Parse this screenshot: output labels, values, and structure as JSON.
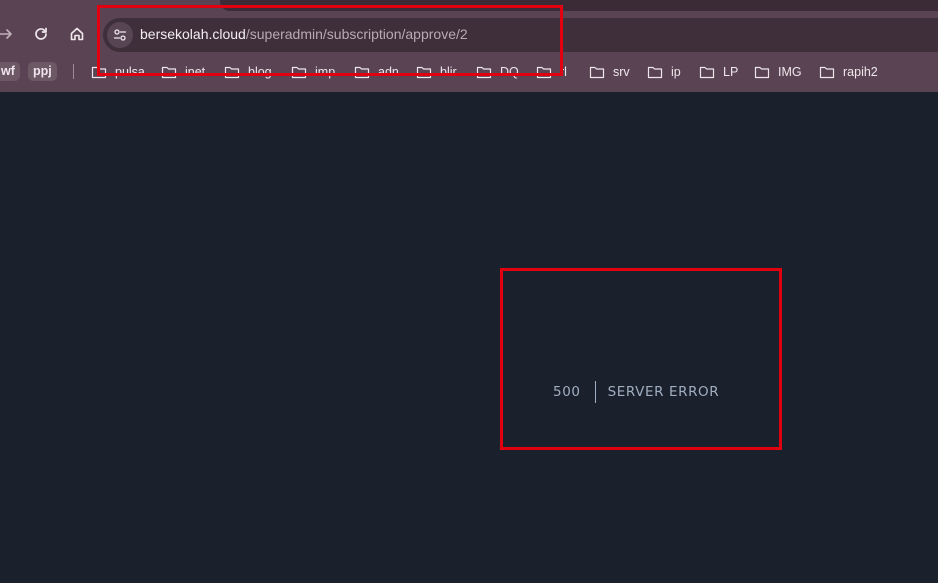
{
  "browser": {
    "url_host": "bersekolah.cloud",
    "url_path": "/superadmin/subscription/approve/2"
  },
  "bookmarks": {
    "chips": [
      "wf",
      "ppj"
    ],
    "folders": [
      "pulsa",
      "inet",
      "blog",
      "imp",
      "adn",
      "blir",
      "DQ",
      "rl",
      "srv",
      "ip",
      "LP",
      "IMG",
      "rapih2"
    ]
  },
  "error": {
    "code": "500",
    "message": "SERVER ERROR"
  },
  "colors": {
    "browser_chrome": "#5a4453",
    "page_background": "#1a202c",
    "error_text": "#a0aec0",
    "annotation_red": "#e0000f"
  },
  "icons": [
    "forward-arrow-icon",
    "reload-icon",
    "home-icon",
    "site-settings-icon",
    "folder-icon"
  ]
}
